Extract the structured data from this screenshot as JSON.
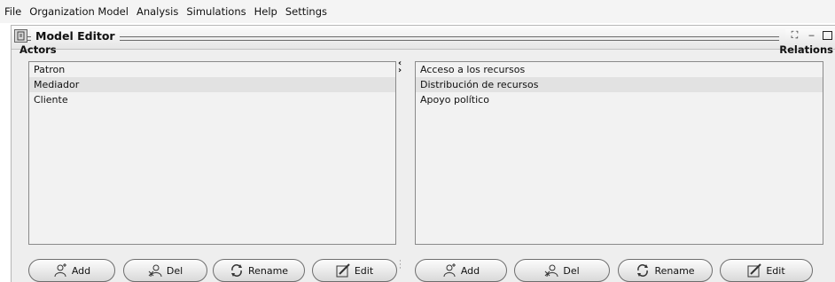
{
  "menu": [
    "File",
    "Organization Model",
    "Analysis",
    "Simulations",
    "Help",
    "Settings"
  ],
  "window": {
    "title": "Model Editor",
    "icon": "app-icon",
    "restore_glyph": "⛶",
    "minimize_glyph": "‒"
  },
  "actors": {
    "label": "Actors",
    "items": [
      "Patron",
      "Mediador",
      "Cliente"
    ],
    "selected_index": 1
  },
  "relations": {
    "label": "Relations",
    "items": [
      "Acceso a los recursos",
      "Distribución de recursos",
      "Apoyo político"
    ],
    "selected_index": 1
  },
  "splitter": {
    "left_arrow": "‹",
    "right_arrow": "›"
  },
  "buttons": {
    "add": "Add",
    "del": "Del",
    "rename": "Rename",
    "edit": "Edit"
  },
  "icons": {
    "add": "add-user-icon",
    "del": "delete-user-icon",
    "rename": "rename-arrows-icon",
    "edit": "edit-pencil-icon"
  }
}
